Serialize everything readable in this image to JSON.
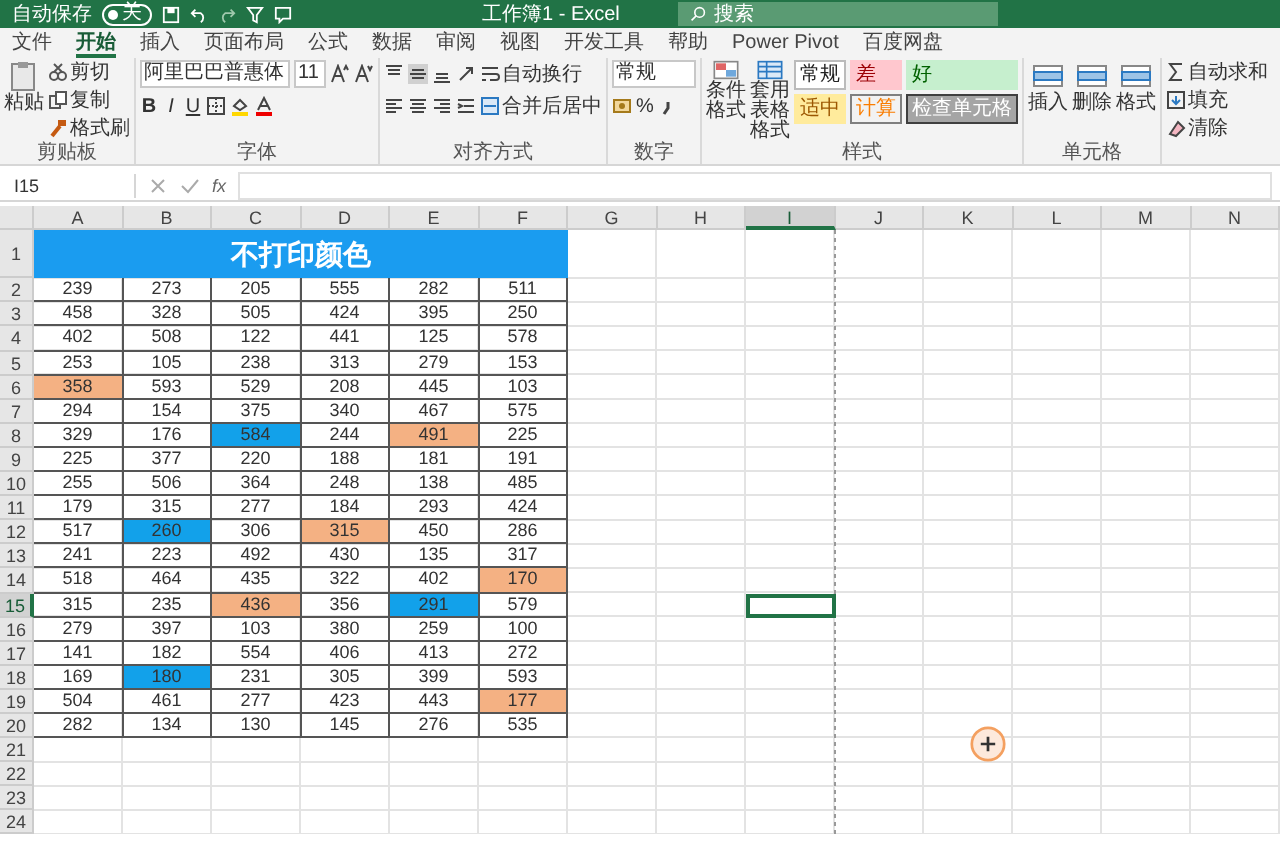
{
  "title_bar": {
    "autosave_label": "自动保存",
    "autosave_on": false,
    "autosave_state": "关",
    "title": "工作簿1 - Excel",
    "search_placeholder": "搜索"
  },
  "tabs": [
    {
      "label": "文件",
      "selected": false
    },
    {
      "label": "开始",
      "selected": true
    },
    {
      "label": "插入",
      "selected": false
    },
    {
      "label": "页面布局",
      "selected": false
    },
    {
      "label": "公式",
      "selected": false
    },
    {
      "label": "数据",
      "selected": false
    },
    {
      "label": "审阅",
      "selected": false
    },
    {
      "label": "视图",
      "selected": false
    },
    {
      "label": "开发工具",
      "selected": false
    },
    {
      "label": "帮助",
      "selected": false
    },
    {
      "label": "Power Pivot",
      "selected": false
    },
    {
      "label": "百度网盘",
      "selected": false
    }
  ],
  "ribbon": {
    "clipboard": {
      "label": "剪贴板",
      "paste": "粘贴",
      "items": [
        "剪切",
        "复制",
        "格式刷"
      ]
    },
    "font": {
      "label": "字体",
      "font_name": "阿里巴巴普惠体",
      "font_size": "11",
      "styles": [
        "B",
        "I",
        "U"
      ]
    },
    "alignment": {
      "label": "对齐方式",
      "wrap": "自动换行",
      "merge": "合并后居中"
    },
    "number": {
      "label": "数字",
      "format": "常规",
      "percent": "%"
    },
    "styles": {
      "label": "样式",
      "conditional": "条件格式",
      "table": "套用表格格式",
      "cells": [
        {
          "text": "常规",
          "kind": "normal"
        },
        {
          "text": "差",
          "kind": "bad"
        },
        {
          "text": "好",
          "kind": "good"
        },
        {
          "text": "适中",
          "kind": "neutral"
        },
        {
          "text": "计算",
          "kind": "calc"
        },
        {
          "text": "检查单元格",
          "kind": "check"
        }
      ]
    },
    "cells": {
      "label": "单元格",
      "items": [
        "插入",
        "删除",
        "格式"
      ]
    },
    "editing": {
      "items": [
        "自动求和",
        "填充",
        "清除"
      ]
    }
  },
  "formula_bar": {
    "name_box": "I15",
    "function_label": "fx"
  },
  "sheet": {
    "columns": [
      {
        "label": "A",
        "selected": false
      },
      {
        "label": "B",
        "selected": false
      },
      {
        "label": "C",
        "selected": false
      },
      {
        "label": "D",
        "selected": false
      },
      {
        "label": "E",
        "selected": false
      },
      {
        "label": "F",
        "selected": false
      },
      {
        "label": "G",
        "selected": false
      },
      {
        "label": "H",
        "selected": false
      },
      {
        "label": "I",
        "selected": true
      },
      {
        "label": "J",
        "selected": false
      },
      {
        "label": "K",
        "selected": false
      },
      {
        "label": "L",
        "selected": false
      },
      {
        "label": "M",
        "selected": false
      },
      {
        "label": "N",
        "selected": false
      }
    ],
    "rows": [
      {
        "header": "1",
        "selected": false,
        "title": "不打印颜色"
      },
      {
        "header": "2",
        "selected": false,
        "cells": [
          {
            "text": "239"
          },
          {
            "text": "273"
          },
          {
            "text": "205"
          },
          {
            "text": "555"
          },
          {
            "text": "282"
          },
          {
            "text": "511"
          }
        ]
      },
      {
        "header": "3",
        "selected": false,
        "cells": [
          {
            "text": "458"
          },
          {
            "text": "328"
          },
          {
            "text": "505"
          },
          {
            "text": "424"
          },
          {
            "text": "395"
          },
          {
            "text": "250"
          }
        ]
      },
      {
        "header": "4",
        "selected": false,
        "cells": [
          {
            "text": "402"
          },
          {
            "text": "508"
          },
          {
            "text": "122"
          },
          {
            "text": "441"
          },
          {
            "text": "125"
          },
          {
            "text": "578"
          }
        ]
      },
      {
        "header": "5",
        "selected": false,
        "cells": [
          {
            "text": "253"
          },
          {
            "text": "105"
          },
          {
            "text": "238"
          },
          {
            "text": "313"
          },
          {
            "text": "279"
          },
          {
            "text": "153"
          }
        ]
      },
      {
        "header": "6",
        "selected": false,
        "cells": [
          {
            "text": "358",
            "color": "#f4b183"
          },
          {
            "text": "593"
          },
          {
            "text": "529"
          },
          {
            "text": "208"
          },
          {
            "text": "445"
          },
          {
            "text": "103"
          }
        ]
      },
      {
        "header": "7",
        "selected": false,
        "cells": [
          {
            "text": "294"
          },
          {
            "text": "154"
          },
          {
            "text": "375"
          },
          {
            "text": "340"
          },
          {
            "text": "467"
          },
          {
            "text": "575"
          }
        ]
      },
      {
        "header": "8",
        "selected": false,
        "cells": [
          {
            "text": "329"
          },
          {
            "text": "176"
          },
          {
            "text": "584",
            "color": "#12a1ea"
          },
          {
            "text": "244"
          },
          {
            "text": "491",
            "color": "#f4b183"
          },
          {
            "text": "225"
          }
        ]
      },
      {
        "header": "9",
        "selected": false,
        "cells": [
          {
            "text": "225"
          },
          {
            "text": "377"
          },
          {
            "text": "220"
          },
          {
            "text": "188"
          },
          {
            "text": "181"
          },
          {
            "text": "191"
          }
        ]
      },
      {
        "header": "10",
        "selected": false,
        "cells": [
          {
            "text": "255"
          },
          {
            "text": "506"
          },
          {
            "text": "364"
          },
          {
            "text": "248"
          },
          {
            "text": "138"
          },
          {
            "text": "485"
          }
        ]
      },
      {
        "header": "11",
        "selected": false,
        "cells": [
          {
            "text": "179"
          },
          {
            "text": "315"
          },
          {
            "text": "277"
          },
          {
            "text": "184"
          },
          {
            "text": "293"
          },
          {
            "text": "424"
          }
        ]
      },
      {
        "header": "12",
        "selected": false,
        "cells": [
          {
            "text": "517"
          },
          {
            "text": "260",
            "color": "#12a1ea"
          },
          {
            "text": "306"
          },
          {
            "text": "315",
            "color": "#f4b183"
          },
          {
            "text": "450"
          },
          {
            "text": "286"
          }
        ]
      },
      {
        "header": "13",
        "selected": false,
        "cells": [
          {
            "text": "241"
          },
          {
            "text": "223"
          },
          {
            "text": "492"
          },
          {
            "text": "430"
          },
          {
            "text": "135"
          },
          {
            "text": "317"
          }
        ]
      },
      {
        "header": "14",
        "selected": false,
        "cells": [
          {
            "text": "518"
          },
          {
            "text": "464"
          },
          {
            "text": "435"
          },
          {
            "text": "322"
          },
          {
            "text": "402"
          },
          {
            "text": "170",
            "color": "#f4b183"
          }
        ]
      },
      {
        "header": "15",
        "selected": true,
        "cells": [
          {
            "text": "315"
          },
          {
            "text": "235"
          },
          {
            "text": "436",
            "color": "#f4b183"
          },
          {
            "text": "356"
          },
          {
            "text": "291",
            "color": "#12a1ea"
          },
          {
            "text": "579"
          }
        ]
      },
      {
        "header": "16",
        "selected": false,
        "cells": [
          {
            "text": "279"
          },
          {
            "text": "397"
          },
          {
            "text": "103"
          },
          {
            "text": "380"
          },
          {
            "text": "259"
          },
          {
            "text": "100"
          }
        ]
      },
      {
        "header": "17",
        "selected": false,
        "cells": [
          {
            "text": "141"
          },
          {
            "text": "182"
          },
          {
            "text": "554"
          },
          {
            "text": "406"
          },
          {
            "text": "413"
          },
          {
            "text": "272"
          }
        ]
      },
      {
        "header": "18",
        "selected": false,
        "cells": [
          {
            "text": "169"
          },
          {
            "text": "180",
            "color": "#12a1ea"
          },
          {
            "text": "231"
          },
          {
            "text": "305"
          },
          {
            "text": "399"
          },
          {
            "text": "593"
          }
        ]
      },
      {
        "header": "19",
        "selected": false,
        "cells": [
          {
            "text": "504"
          },
          {
            "text": "461"
          },
          {
            "text": "277"
          },
          {
            "text": "423"
          },
          {
            "text": "443"
          },
          {
            "text": "177",
            "color": "#f4b183"
          }
        ]
      },
      {
        "header": "20",
        "selected": false,
        "cells": [
          {
            "text": "282"
          },
          {
            "text": "134"
          },
          {
            "text": "130"
          },
          {
            "text": "145"
          },
          {
            "text": "276"
          },
          {
            "text": "535"
          }
        ]
      },
      {
        "header": "21",
        "selected": false
      },
      {
        "header": "22",
        "selected": false
      },
      {
        "header": "23",
        "selected": false
      },
      {
        "header": "24",
        "selected": false
      }
    ]
  }
}
